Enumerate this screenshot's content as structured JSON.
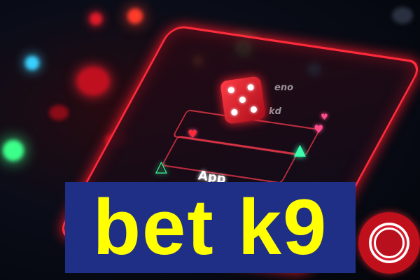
{
  "banner": {
    "title": "bet k9",
    "title_color": "#ffff00",
    "box_color": "#1f2f86"
  },
  "phone_screen": {
    "app_label": "App",
    "text_line_1": "eno",
    "text_line_2": "kd"
  },
  "accent_colors": {
    "neon_red": "#ff2a3a",
    "neon_green": "#38ff9a",
    "background": "#05070d"
  },
  "icons": [
    "dice-icon",
    "casino-chip-icon",
    "up-triangle-icon",
    "heart-icon"
  ]
}
